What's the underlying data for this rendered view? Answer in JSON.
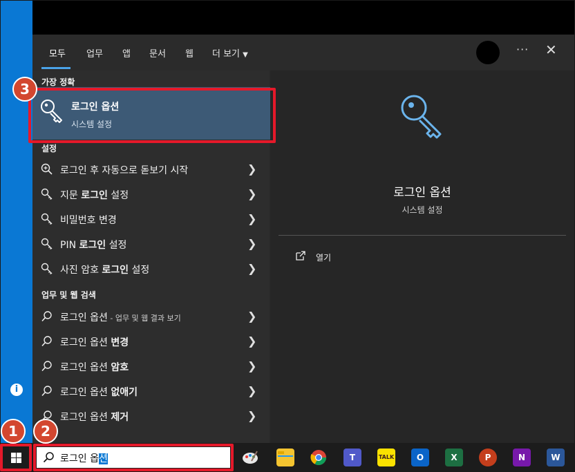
{
  "tabs": [
    "모두",
    "업무",
    "앱",
    "문서",
    "웹",
    "더 보기"
  ],
  "more_icon": "···",
  "close_icon": "✕",
  "best_match": {
    "header": "가장 정확",
    "title": "로그인 옵션",
    "subtitle": "시스템 설정"
  },
  "settings": {
    "header": "설정",
    "items": [
      {
        "pre": "로그인 후 자동으로 돋보기 시작",
        "bold": "",
        "post": ""
      },
      {
        "pre": "지문 ",
        "bold": "로그인",
        "post": " 설정"
      },
      {
        "pre": "비밀번호 변경",
        "bold": "",
        "post": ""
      },
      {
        "pre": "PIN ",
        "bold": "로그인",
        "post": " 설정"
      },
      {
        "pre": "사진 암호 ",
        "bold": "로그인",
        "post": " 설정"
      }
    ]
  },
  "web": {
    "header": "업무 및 웹 검색",
    "items": [
      {
        "pre": "로그인 옵션",
        "bold": "",
        "sub": " - 업무 및 웹 결과 보기"
      },
      {
        "pre": "로그인 옵션 ",
        "bold": "변경",
        "sub": ""
      },
      {
        "pre": "로그인 옵션 ",
        "bold": "암호",
        "sub": ""
      },
      {
        "pre": "로그인 옵션 ",
        "bold": "없애기",
        "sub": ""
      },
      {
        "pre": "로그인 옵션 ",
        "bold": "제거",
        "sub": ""
      }
    ]
  },
  "preview": {
    "title": "로그인 옵션",
    "subtitle": "시스템 설정",
    "open_label": "열기"
  },
  "search": {
    "query_before": "로그인 옵",
    "query_selected": "션"
  },
  "badges": [
    "1",
    "2",
    "3"
  ],
  "info_icon": "i",
  "taskbar_apps": [
    {
      "name": "paint-app",
      "color": "#1c1c1c",
      "label": ""
    },
    {
      "name": "file-explorer",
      "color": "#f4c430",
      "label": ""
    },
    {
      "name": "chrome",
      "color": "#1c1c1c",
      "label": ""
    },
    {
      "name": "teams",
      "color": "#5059c9",
      "label": "T"
    },
    {
      "name": "kakaotalk",
      "color": "#fae100",
      "label": "TALK"
    },
    {
      "name": "outlook",
      "color": "#0a64c8",
      "label": "O"
    },
    {
      "name": "excel",
      "color": "#1d6f42",
      "label": "X"
    },
    {
      "name": "powerpoint",
      "color": "#c43e1c",
      "label": "P"
    },
    {
      "name": "onenote",
      "color": "#7719aa",
      "label": "N"
    },
    {
      "name": "word",
      "color": "#2b579a",
      "label": "W"
    }
  ],
  "accent": "#4aa3e8",
  "highlight": "#e5192a"
}
